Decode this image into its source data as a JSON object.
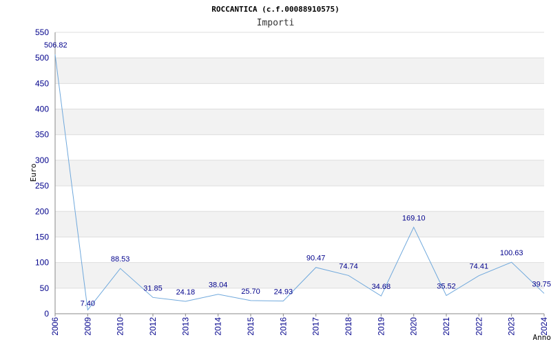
{
  "chart_data": {
    "type": "line",
    "title": "ROCCANTICA (c.f.00088910575)",
    "subtitle": "Importi",
    "xlabel": "Anno",
    "ylabel": "Euro",
    "ylim": [
      0,
      550
    ],
    "yticks": [
      "0",
      "50",
      "100",
      "150",
      "200",
      "250",
      "300",
      "350",
      "400",
      "450",
      "500",
      "550"
    ],
    "grid": true,
    "series": [
      {
        "x": [
          "2006",
          "2009",
          "2010",
          "2012",
          "2013",
          "2014",
          "2015",
          "2016",
          "2017",
          "2018",
          "2019",
          "2020",
          "2021",
          "2022",
          "2023",
          "2024"
        ],
        "values": [
          506.82,
          7.4,
          88.53,
          31.85,
          24.18,
          38.04,
          25.7,
          24.93,
          90.47,
          74.74,
          34.68,
          169.1,
          35.52,
          74.41,
          100.63,
          39.75
        ],
        "labels": [
          "506.82",
          "7.40",
          "88.53",
          "31.85",
          "24.18",
          "38.04",
          "25.70",
          "24.93",
          "90.47",
          "74.74",
          "34.68",
          "169.10",
          "35.52",
          "74.41",
          "100.63",
          "39.75"
        ]
      }
    ],
    "colors": {
      "line": "#6fa8dc",
      "label": "#00008b",
      "band": "#f2f2f2",
      "gridline": "#dddddd",
      "axis": "#888888"
    }
  }
}
